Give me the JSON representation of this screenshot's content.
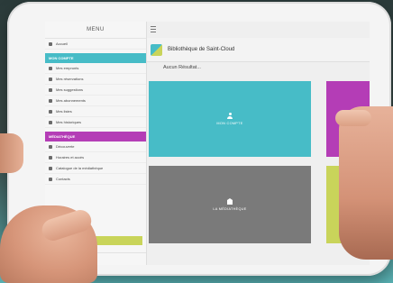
{
  "menu": {
    "title": "MENU"
  },
  "sidebar": {
    "items_top": [
      {
        "label": "Accueil"
      }
    ],
    "section1": {
      "title": "MON COMPTE"
    },
    "items_section1": [
      {
        "label": "Mes emprunts"
      },
      {
        "label": "Mes réservations"
      },
      {
        "label": "Mes suggestions"
      },
      {
        "label": "Mes abonnements"
      },
      {
        "label": "Mes listes"
      },
      {
        "label": "Mes historiques"
      }
    ],
    "section2": {
      "title": "MÉDIATHÈQUE"
    },
    "items_section2": [
      {
        "label": "Découverte"
      },
      {
        "label": "Horaires et accès"
      },
      {
        "label": "Catalogue de la médiathèque"
      },
      {
        "label": "Contacts"
      }
    ],
    "footer": {
      "label": "Voir toutes les infos"
    }
  },
  "header": {
    "title": "Bibliothèque de Saint-Cloud"
  },
  "notice": "Aucun Résultat...",
  "tiles": [
    {
      "label": "MON COMPTE",
      "color": "#47bcc7"
    },
    {
      "label": "LA MÉDIATHÈQUE",
      "color": "#7a7a7a"
    }
  ],
  "colors": {
    "teal": "#47bcc7",
    "magenta": "#b43db6",
    "lime": "#c9d45a",
    "gray": "#7a7a7a"
  }
}
